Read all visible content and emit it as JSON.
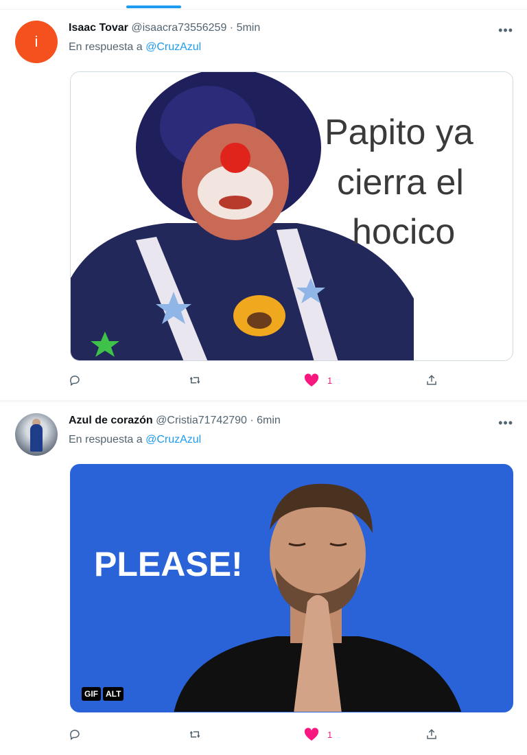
{
  "tweets": [
    {
      "avatar_letter": "i",
      "author": "Isaac Tovar",
      "handle": "@isaacra73556259",
      "separator": "·",
      "time": "5min",
      "reply_prefix": "En respuesta a",
      "reply_to": "@CruzAzul",
      "media_text": [
        "Papito ya",
        "cierra el",
        "hocico"
      ],
      "likes": "1"
    },
    {
      "author": "Azul de corazón",
      "handle": "@Cristia71742790",
      "separator": "·",
      "time": "6min",
      "reply_prefix": "En respuesta a",
      "reply_to": "@CruzAzul",
      "media_text": "PLEASE!",
      "badges": [
        "GIF",
        "ALT"
      ],
      "likes": "1"
    }
  ],
  "more_label": "•••",
  "colors": {
    "accent": "#1d9bf0",
    "like": "#f91880",
    "muted": "#536471",
    "gif_bg": "#2a63d8"
  },
  "icons": [
    "reply-icon",
    "retweet-icon",
    "heart-icon",
    "share-icon",
    "more-icon"
  ]
}
